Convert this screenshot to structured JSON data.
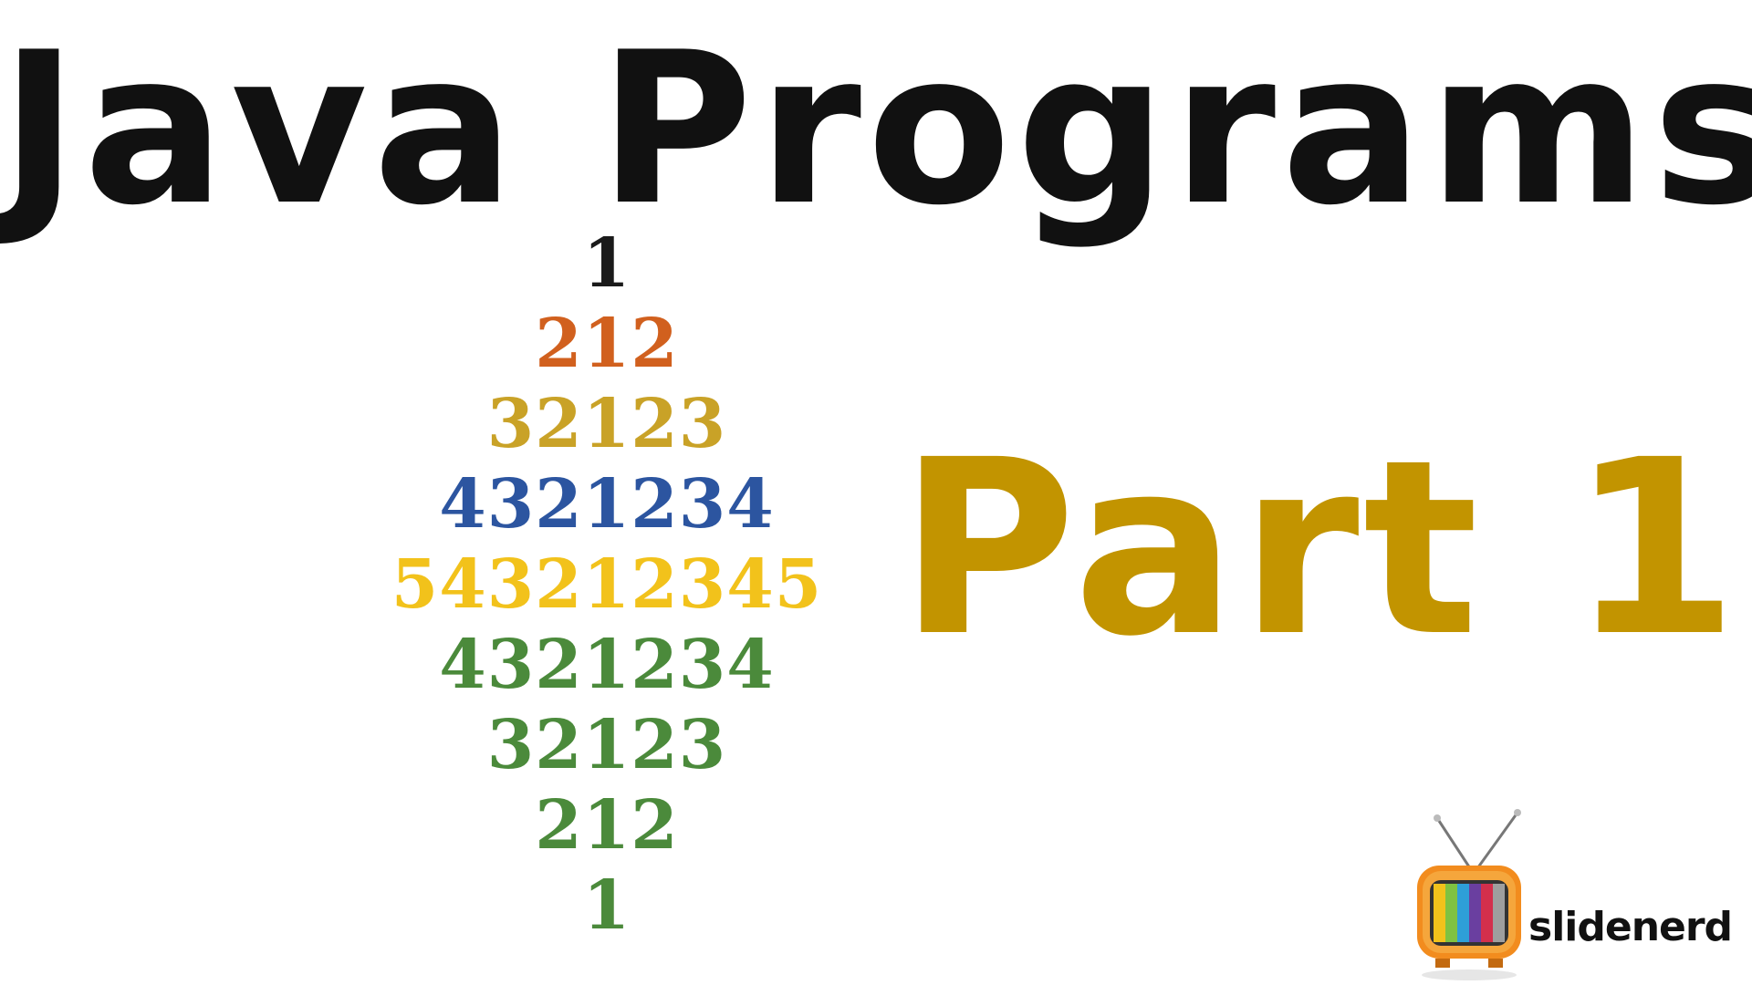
{
  "title": "Java Programs",
  "part_label": "Part 1",
  "pyramid": {
    "rows": [
      {
        "text": "1",
        "color": "#1a1a1a"
      },
      {
        "text": "212",
        "color": "#D1601E"
      },
      {
        "text": "32123",
        "color": "#C9A227"
      },
      {
        "text": "4321234",
        "color": "#2C55A0"
      },
      {
        "text": "543212345",
        "color": "#F2C21B"
      },
      {
        "text": "4321234",
        "color": "#4B8A3B"
      },
      {
        "text": "32123",
        "color": "#4B8A3B"
      },
      {
        "text": "212",
        "color": "#4B8A3B"
      },
      {
        "text": "1",
        "color": "#4B8A3B"
      }
    ]
  },
  "colors": {
    "title": "#111111",
    "part": "#C29400",
    "logo_tv_body": "#F28C1E"
  },
  "logo": {
    "brand_name": "slidenerd",
    "icon": "tv-icon"
  }
}
